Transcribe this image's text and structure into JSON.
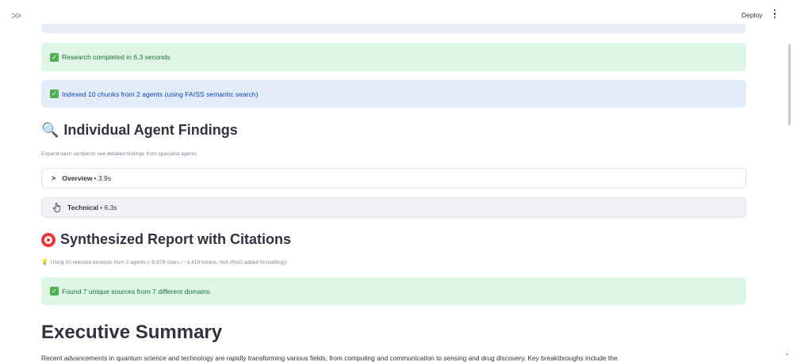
{
  "header": {
    "expand_icon": "chevron-double-right-icon",
    "deploy_label": "Deploy",
    "menu_icon": "kebab-menu-icon"
  },
  "alerts": {
    "research": "Research completed in 6.3 seconds",
    "indexed": "Indexed 10 chunks from 2 agents (using FAISS semantic search)",
    "sources": "Found 7 unique sources from 7 different domains"
  },
  "findings": {
    "emoji": "🔍",
    "heading": "Individual Agent Findings",
    "caption": "Expand each section to see detailed findings from specialist agents",
    "items": [
      {
        "title": "Overview",
        "duration": "• 3.9s"
      },
      {
        "title": "Technical",
        "duration": "• 6.3s"
      }
    ]
  },
  "report": {
    "heading": "Synthesized Report with Citations",
    "caption": "Using 10 relevant excerpts from 2 agents (~5,678 chars / ~1,419 tokens, N/A (RAG added formatting))"
  },
  "summary": {
    "heading": "Executive Summary",
    "text": "Recent advancements in quantum science and technology are rapidly transforming various fields, from computing and communication to sensing and drug discovery. Key breakthroughs include the"
  },
  "colors": {
    "success_bg": "#dff6e6",
    "success_text": "#177233",
    "info_bg": "#e2ecfa",
    "info_text": "#0f4aa4"
  }
}
